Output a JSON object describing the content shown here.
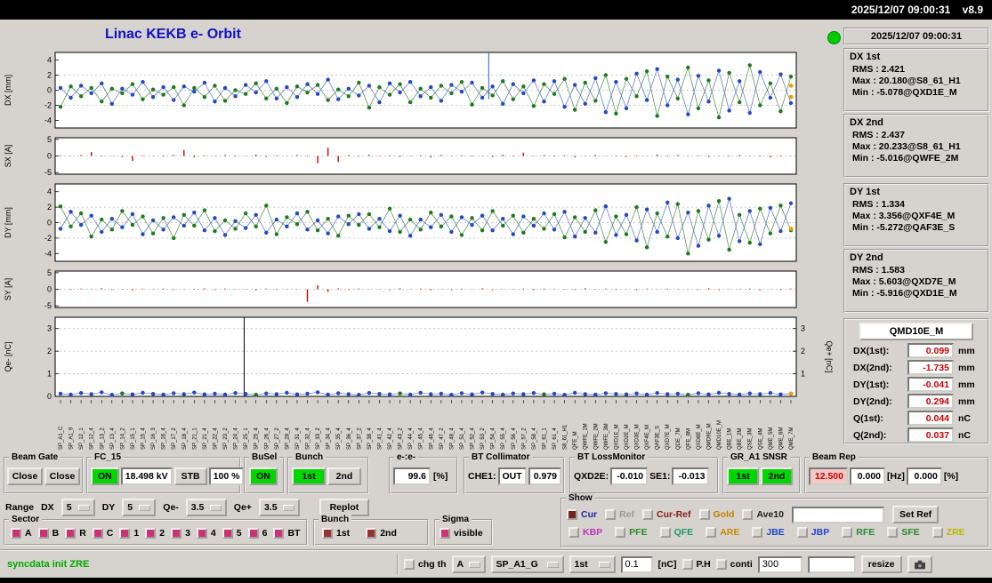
{
  "header": {
    "datetime": "2025/12/07 09:00:31",
    "version": "v8.9"
  },
  "title": "Linac KEKB e- Orbit",
  "clock": {
    "text": "2025/12/07 09:00:31"
  },
  "stats": [
    {
      "title": "DX 1st",
      "lines": [
        "RMS : 2.421",
        "Max : 20.180@S8_61_H1",
        "Min : -5.078@QXD1E_M"
      ]
    },
    {
      "title": "DX 2nd",
      "lines": [
        "RMS : 2.437",
        "Max : 20.233@S8_61_H1",
        "Min : -5.016@QWFE_2M"
      ]
    },
    {
      "title": "DY 1st",
      "lines": [
        "RMS : 1.334",
        "Max : 3.356@QXF4E_M",
        "Min : -5.272@QAF3E_S"
      ]
    },
    {
      "title": "DY 2nd",
      "lines": [
        "RMS : 1.583",
        "Max : 5.603@QXD7E_M",
        "Min : -5.916@QXD1E_M"
      ]
    }
  ],
  "monitor": {
    "title": "QMD10E_M",
    "value_color": "#cc0000",
    "rows": [
      {
        "label": "DX(1st):",
        "value": "0.099",
        "unit": "mm"
      },
      {
        "label": "DX(2nd):",
        "value": "-1.735",
        "unit": "mm"
      },
      {
        "label": "DY(1st):",
        "value": "-0.041",
        "unit": "mm"
      },
      {
        "label": "DY(2nd):",
        "value": "0.294",
        "unit": "mm"
      },
      {
        "label": "Q(1st):",
        "value": "0.044",
        "unit": "nC"
      },
      {
        "label": "Q(2nd):",
        "value": "0.037",
        "unit": "nC"
      }
    ]
  },
  "controls": {
    "beam_gate": {
      "title": "Beam Gate",
      "close1": "Close",
      "close2": "Close"
    },
    "fc15": {
      "title": "FC_15",
      "on": "ON",
      "kv": "18.498 kV",
      "stb": "STB",
      "pct": "100 %"
    },
    "busel": {
      "title": "BuSel",
      "on": "ON"
    },
    "bunch1": {
      "title": "Bunch",
      "b1": "1st",
      "b2": "2nd"
    },
    "ee": {
      "title": "e-:e-",
      "value": "99.6",
      "unit": "[%]"
    },
    "btcol": {
      "title": "BT Collimator",
      "che1": "CHE1:",
      "out": "OUT",
      "val": "0.979"
    },
    "btloss": {
      "title": "BT LossMonitor",
      "l1": "QXD2E:",
      "v1": "-0.010",
      "l2": "SE1:",
      "v2": "-0.013"
    },
    "gra1": {
      "title": "GR_A1  SNSR",
      "b1": "1st",
      "b2": "2nd"
    },
    "beamrep": {
      "title": "Beam Rep",
      "v1": "12.500",
      "v1_color": "#cc0000",
      "v1_bg": "#f2c8c8",
      "v2": "0.000",
      "hz": "[Hz]",
      "v3": "0.000",
      "pct": "[%]"
    },
    "range": {
      "label": "Range",
      "dx": "DX",
      "dx_val": "5",
      "dy": "DY",
      "dy_val": "5",
      "qem": "Qe-",
      "qem_val": "3.5",
      "qep": "Qe+",
      "qep_val": "3.5",
      "replot": "Replot"
    },
    "sector": {
      "title": "Sector",
      "box": "#cc3377",
      "items": [
        "A",
        "B",
        "R",
        "C",
        "1",
        "2",
        "3",
        "4",
        "5",
        "6",
        "BT"
      ]
    },
    "bunch2": {
      "title": "Bunch",
      "box": "#993333",
      "items": [
        "1st",
        "2nd"
      ]
    },
    "sigma": {
      "title": "Sigma",
      "box": "#cc3377",
      "label": "visible"
    },
    "show": {
      "title": "Show",
      "set_ref": "Set Ref",
      "row1": [
        {
          "label": "Cur",
          "color": "#2222aa",
          "box": "#7a2222"
        },
        {
          "label": "Ref",
          "color": "#999999"
        },
        {
          "label": "Cur-Ref",
          "color": "#8a1a1a"
        },
        {
          "label": "Gold",
          "color": "#c08000"
        },
        {
          "label": "Ave10",
          "color": "#222222"
        }
      ],
      "row2": [
        {
          "label": "KBP",
          "color": "#bb33bb"
        },
        {
          "label": "PFE",
          "color": "#2a8a2a"
        },
        {
          "label": "QFE",
          "color": "#1a9a6a"
        },
        {
          "label": "ARE",
          "color": "#cc8800"
        },
        {
          "label": "JBE",
          "color": "#2244cc"
        },
        {
          "label": "JBP",
          "color": "#2244cc"
        },
        {
          "label": "RFE",
          "color": "#2a8a2a"
        },
        {
          "label": "SFE",
          "color": "#2a8a2a"
        },
        {
          "label": "ZRE",
          "color": "#b8b800"
        }
      ]
    }
  },
  "statusbar": {
    "message": "syncdata init ZRE",
    "message_color": "#00a800",
    "chg_th": "chg th",
    "opt_a": "A",
    "opt_sp": "SP_A1_G",
    "opt_1st": "1st",
    "th_val": "0.1",
    "nc": "[nC]",
    "ph": "P.H",
    "conti": "conti",
    "val300": "300",
    "resize": "resize"
  },
  "plots": {
    "x_count": 72,
    "marker_green": "#1e7a1e",
    "marker_blue": "#2448c0",
    "bar_color": "#d40000",
    "gold_color": "#f0a000",
    "dx": {
      "label": "DX [mm]",
      "ymin": -5,
      "ymax": 5,
      "ticks": [
        4,
        2,
        0,
        -2,
        -4
      ],
      "grid": [
        2,
        0,
        -2
      ],
      "green": [
        -2.2,
        0.5,
        -0.8,
        0.3,
        -1.5,
        0.2,
        -0.4,
        0.8,
        -1.2,
        0.1,
        -0.6,
        0.4,
        -2.0,
        0.3,
        -0.9,
        0.6,
        -1.4,
        0.0,
        -0.5,
        0.9,
        -1.1,
        0.2,
        -1.7,
        0.5,
        -0.3,
        0.7,
        -1.3,
        0.1,
        -0.8,
        1.0,
        -2.3,
        0.4,
        -0.6,
        0.8,
        -1.6,
        0.2,
        -1.0,
        0.6,
        -0.4,
        1.1,
        -1.9,
        0.3,
        -0.7,
        1.2,
        -1.2,
        0.5,
        -2.1,
        0.8,
        -0.5,
        1.5,
        -2.6,
        1.0,
        -1.4,
        2.0,
        -3.1,
        1.5,
        -0.8,
        2.5,
        -3.4,
        1.8,
        -1.1,
        3.0,
        -2.4,
        1.3,
        -3.6,
        2.3,
        -1.6,
        3.3,
        -2.0,
        0.9,
        -2.8,
        1.8
      ],
      "blue": [
        0.3,
        -1.0,
        0.6,
        -0.4,
        0.9,
        -1.8,
        0.2,
        -0.6,
        1.1,
        -0.9,
        0.4,
        -1.3,
        0.5,
        -0.2,
        1.0,
        -1.5,
        0.3,
        -0.8,
        0.7,
        -0.3,
        1.2,
        -1.1,
        0.4,
        -0.9,
        0.8,
        -0.5,
        1.4,
        -1.2,
        0.2,
        -0.7,
        0.6,
        -1.6,
        0.9,
        -0.3,
        1.1,
        -0.8,
        0.4,
        -1.4,
        0.7,
        -0.2,
        1.0,
        -1.0,
        0.5,
        -1.8,
        0.8,
        -0.4,
        1.3,
        -1.5,
        1.2,
        -2.2,
        0.7,
        -1.8,
        1.6,
        -2.9,
        1.1,
        -2.4,
        2.2,
        -1.3,
        2.8,
        -2.0,
        1.4,
        -3.2,
        1.9,
        -1.5,
        2.6,
        -2.7,
        1.2,
        -3.0,
        2.4,
        -1.0,
        2.1,
        -1.7
      ],
      "spike": {
        "f": 0.585,
        "from": 5,
        "to": -1.2,
        "color": "#3558c0"
      },
      "gold": [
        [
          0.993,
          0.6
        ],
        [
          0.993,
          -0.9
        ]
      ]
    },
    "sx": {
      "label": "SX [A]",
      "ymin": -5.5,
      "ymax": 5.5,
      "ticks": [
        5,
        0,
        -5
      ],
      "grid": [
        0
      ],
      "bars": [
        0.2,
        -0.1,
        0.3,
        1.2,
        -0.2,
        0.1,
        -0.3,
        -1.5,
        0.2,
        0.1,
        -0.2,
        0.3,
        1.8,
        -0.4,
        0.2,
        -0.1,
        0.3,
        -0.2,
        0.1,
        0.4,
        -0.3,
        0.2,
        -0.1,
        0.3,
        -0.2,
        -2.2,
        2.5,
        -1.8,
        0.3,
        -0.2,
        0.4,
        -0.1,
        0.2,
        -0.3,
        0.1,
        0.2,
        -0.4,
        0.3,
        -0.1,
        0.2,
        -0.2,
        0.1,
        -0.3,
        0.4,
        -0.2,
        1.0,
        -0.1,
        0.3,
        -0.2,
        0.2,
        -0.4,
        0.1,
        0.3,
        -0.1,
        0.2,
        -0.3,
        0.2,
        -0.1,
        0.4,
        -0.2,
        0.3,
        -0.1,
        0.2,
        -0.3,
        0.1,
        -0.2,
        0.3,
        -0.1,
        0.2,
        -0.4,
        0.2,
        -0.1
      ]
    },
    "dy": {
      "label": "DY [mm]",
      "ymin": -5,
      "ymax": 5,
      "ticks": [
        4,
        2,
        0,
        -2,
        -4
      ],
      "grid": [
        2,
        0,
        -2
      ],
      "green": [
        2.1,
        -0.5,
        1.2,
        -1.8,
        0.4,
        -0.9,
        1.5,
        -0.3,
        0.8,
        -1.4,
        0.6,
        -2.0,
        1.0,
        -0.4,
        1.6,
        -1.1,
        0.3,
        -0.8,
        1.2,
        -0.5,
        2.2,
        -1.5,
        0.7,
        -0.2,
        1.4,
        -1.0,
        0.5,
        -1.7,
        0.9,
        -0.3,
        1.1,
        -0.6,
        1.8,
        -1.2,
        0.4,
        -0.9,
        1.3,
        -0.5,
        0.8,
        -1.6,
        0.6,
        -1.0,
        1.5,
        -0.4,
        0.9,
        -1.3,
        0.5,
        -0.8,
        1.1,
        -1.9,
        0.7,
        -1.2,
        1.6,
        -2.5,
        0.8,
        -1.5,
        2.0,
        -3.2,
        1.2,
        -1.8,
        2.4,
        -4.0,
        1.5,
        -2.2,
        2.8,
        -3.5,
        1.0,
        -2.6,
        1.8,
        -1.4,
        2.2,
        -1.0
      ],
      "blue": [
        -0.8,
        1.4,
        -0.3,
        0.9,
        -1.2,
        0.5,
        -0.6,
        1.1,
        -1.5,
        0.3,
        -0.9,
        0.7,
        -0.4,
        1.3,
        -1.0,
        0.6,
        -1.6,
        0.2,
        -0.7,
        1.0,
        -1.3,
        0.4,
        -0.5,
        1.2,
        -0.9,
        0.3,
        -1.4,
        0.8,
        -0.2,
        1.1,
        -0.8,
        0.5,
        -1.1,
        0.9,
        -1.7,
        0.4,
        -0.6,
        1.0,
        -1.2,
        0.7,
        -0.3,
        0.9,
        -1.0,
        0.5,
        -1.5,
        0.8,
        -0.4,
        1.2,
        -0.9,
        1.4,
        -1.8,
        0.6,
        -1.3,
        2.1,
        -1.6,
        1.0,
        -2.3,
        1.7,
        -1.2,
        2.6,
        -2.0,
        1.3,
        -3.0,
        2.2,
        -1.7,
        3.1,
        -2.4,
        1.5,
        -2.8,
        1.9,
        -1.1,
        2.5
      ],
      "gold": [
        [
          0.993,
          -0.8
        ]
      ]
    },
    "sy": {
      "label": "SY [A]",
      "ymin": -5.5,
      "ymax": 5.5,
      "ticks": [
        5,
        0,
        -5
      ],
      "grid": [
        0
      ],
      "bars": [
        0.1,
        -0.2,
        0.2,
        -0.1,
        0.3,
        -0.2,
        0.1,
        -0.3,
        0.2,
        -0.1,
        0.2,
        -0.2,
        0.1,
        -0.1,
        0.3,
        -0.2,
        0.2,
        -0.1,
        0.1,
        -0.3,
        0.2,
        -0.2,
        0.1,
        -0.1,
        -3.8,
        1.2,
        -0.8,
        0.3,
        -0.2,
        0.2,
        -0.1,
        0.1,
        -0.2,
        0.3,
        -0.1,
        0.2,
        -0.3,
        0.1,
        -0.2,
        0.2,
        -0.1,
        0.3,
        -0.2,
        0.1,
        -0.1,
        0.2,
        -0.3,
        0.2,
        -0.1,
        0.1,
        -0.2,
        0.3,
        -0.1,
        0.2,
        -0.2,
        0.1,
        -0.3,
        0.2,
        -0.1,
        0.2,
        -0.1,
        0.1,
        -0.2,
        0.3,
        -0.2,
        0.1,
        -0.1,
        0.2,
        -0.3,
        0.1,
        -0.2,
        0.2
      ]
    },
    "qe": {
      "label": "Qe- [nC]",
      "label_right": "Qe+ [nC]",
      "ymin": 0,
      "ymax": 3.5,
      "ticks": [
        0,
        1,
        2,
        3
      ],
      "ticks_right": [
        1,
        2,
        3
      ],
      "grid": [
        1,
        2,
        3
      ],
      "blue": [
        0.12,
        0.08,
        0.15,
        0.1,
        0.18,
        0.07,
        0.13,
        0.09,
        0.16,
        0.11,
        0.08,
        0.14,
        0.1,
        0.17,
        0.09,
        0.12,
        0.08,
        0.15,
        0.11,
        0.07,
        0.13,
        0.1,
        0.16,
        0.09,
        0.12,
        0.18,
        0.08,
        0.14,
        0.1,
        0.07,
        0.15,
        0.11,
        0.09,
        0.13,
        0.08,
        0.16,
        0.1,
        0.12,
        0.07,
        0.14,
        0.09,
        0.17,
        0.11,
        0.08,
        0.13,
        0.1,
        0.15,
        0.09,
        0.12,
        0.07,
        0.16,
        0.1,
        0.08,
        0.14,
        0.11,
        0.09,
        0.13,
        0.08,
        0.15,
        0.1,
        0.12,
        0.07,
        0.14,
        0.09,
        0.16,
        0.11,
        0.08,
        0.13,
        0.1,
        0.15,
        0.09,
        0.12
      ],
      "green_idx": [
        6,
        19,
        33,
        47,
        61
      ],
      "spike": {
        "f": 0.255,
        "from": 3.5,
        "to": 0,
        "color": "#000000"
      },
      "gold": [
        [
          0.993,
          0.12
        ]
      ]
    },
    "bpm_labels": [
      "SP_A1_C",
      "SP_A1_9",
      "SP_12_1",
      "SP_12_4",
      "SP_13_2",
      "SP_13_4",
      "SP_14_2",
      "SP_15_1",
      "SP_15_4",
      "SP_16_3",
      "SP_16_4",
      "SP_17_2",
      "SP_18_4",
      "SP_21_1",
      "SP_21_4",
      "SP_22_4",
      "SP_23_2",
      "SP_24_4",
      "SP_25_1",
      "SP_25_4",
      "SP_26_4",
      "SP_27_2",
      "SP_28_4",
      "SP_31_4",
      "SP_32_4",
      "SP_33_2",
      "SP_34_4",
      "SP_35_4",
      "SP_36_4",
      "SP_37_2",
      "SP_38_4",
      "SP_41_4",
      "SP_42_4",
      "SP_43_2",
      "SP_44_4",
      "SP_45_4",
      "SP_46_4",
      "SP_47_2",
      "SP_48_4",
      "SP_51_4",
      "SP_52_4",
      "SP_53_2",
      "SP_54_4",
      "SP_55_4",
      "SP_56_4",
      "SP_57_2",
      "SP_58_4",
      "SP_61_1",
      "SP_61_4",
      "S8_61_H1",
      "QFE_M",
      "QWFE_1M",
      "QWFE_2M",
      "QWFE_3M",
      "QXD1E_M",
      "QXD2E_M",
      "QXD3E_M",
      "QXF4E_M",
      "QAF3E_S",
      "QXD7E_M",
      "QDE_7M",
      "QFE_8M",
      "QXD8E_M",
      "QMD9E_M",
      "QMD10E_M",
      "QBE_1M",
      "QBE_2M",
      "QSE_3M",
      "QSE_4M",
      "QME_5M",
      "QME_6M",
      "QME_7M"
    ]
  }
}
